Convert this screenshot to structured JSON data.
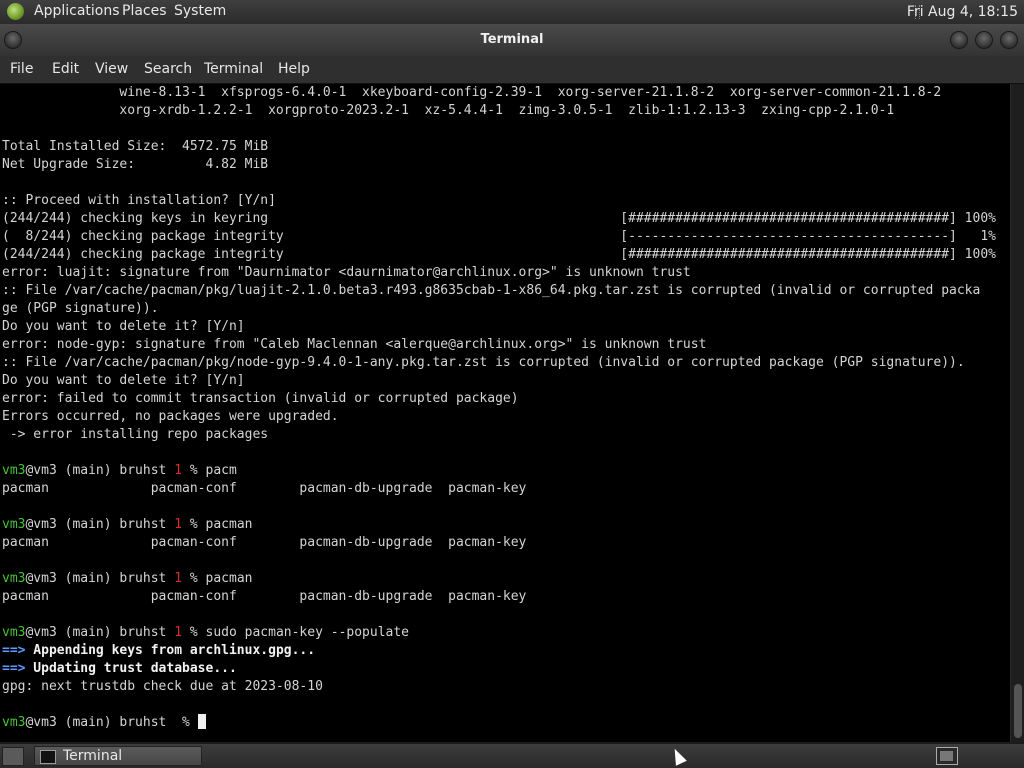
{
  "top_panel": {
    "menus": [
      "Applications",
      "Places",
      "System"
    ],
    "clock": "Fri Aug  4, 18:15"
  },
  "window": {
    "title": "Terminal"
  },
  "menu_bar": [
    "File",
    "Edit",
    "View",
    "Search",
    "Terminal",
    "Help"
  ],
  "terminal": {
    "lines": [
      "               wine-8.13-1  xfsprogs-6.4.0-1  xkeyboard-config-2.39-1  xorg-server-21.1.8-2  xorg-server-common-21.1.8-2",
      "               xorg-xrdb-1.2.2-1  xorgproto-2023.2-1  xz-5.4.4-1  zimg-3.0.5-1  zlib-1:1.2.13-3  zxing-cpp-2.1.0-1",
      "",
      "Total Installed Size:  4572.75 MiB",
      "Net Upgrade Size:         4.82 MiB",
      "",
      ":: Proceed with installation? [Y/n]",
      "(244/244) checking keys in keyring                                             [#########################################] 100%",
      "(  8/244) checking package integrity                                           [-----------------------------------------]   1%",
      "(244/244) checking package integrity                                           [#########################################] 100%",
      "error: luajit: signature from \"Daurnimator <daurnimator@archlinux.org>\" is unknown trust",
      ":: File /var/cache/pacman/pkg/luajit-2.1.0.beta3.r493.g8635cbab-1-x86_64.pkg.tar.zst is corrupted (invalid or corrupted packa",
      "ge (PGP signature)).",
      "Do you want to delete it? [Y/n]",
      "error: node-gyp: signature from \"Caleb Maclennan <alerque@archlinux.org>\" is unknown trust",
      ":: File /var/cache/pacman/pkg/node-gyp-9.4.0-1-any.pkg.tar.zst is corrupted (invalid or corrupted package (PGP signature)).",
      "Do you want to delete it? [Y/n]",
      "error: failed to commit transaction (invalid or corrupted package)",
      "Errors occurred, no packages were upgraded.",
      " -> error installing repo packages",
      ""
    ],
    "prompt": {
      "host": "vm3",
      "rest": "@vm3 (main) bruhst ",
      "code": "1",
      "sep": " % "
    },
    "completion_line": "pacman             pacman-conf        pacman-db-upgrade  pacman-key",
    "commands": [
      "pacm",
      "pacman",
      "pacman",
      "sudo pacman-key --populate"
    ],
    "populate_output": [
      {
        "arrow": "==>",
        "text": " Appending keys from archlinux.gpg..."
      },
      {
        "arrow": "==>",
        "text": " Updating trust database..."
      }
    ],
    "gpg_line": "gpg: next trustdb check due at 2023-08-10",
    "final_prompt_sep": " % "
  },
  "taskbar": {
    "task_label": "Terminal"
  },
  "colors": {
    "prompt_host": "#44c234",
    "exit_code": "#d0302a",
    "arrow": "#5e9cff",
    "background": "#000000"
  }
}
